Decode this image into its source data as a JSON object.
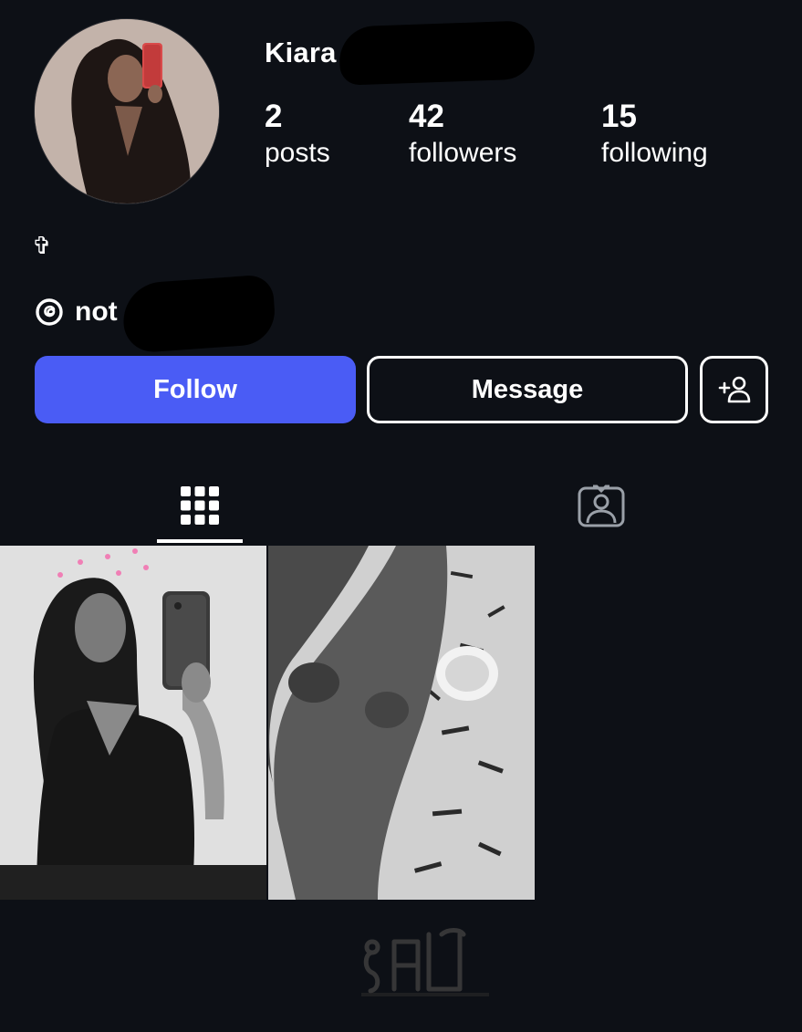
{
  "profile": {
    "username": "Kiara",
    "stats": {
      "posts_count": "2",
      "posts_label": "posts",
      "followers_count": "42",
      "followers_label": "followers",
      "following_count": "15",
      "following_label": "following"
    },
    "bio_symbol": "✞",
    "threads_text": "not"
  },
  "actions": {
    "follow_label": "Follow",
    "message_label": "Message"
  },
  "tabs": [
    {
      "icon": "grid-icon",
      "active": true
    },
    {
      "icon": "tagged-person-icon",
      "active": false
    }
  ],
  "posts": [
    {
      "description_icon": "mirror-selfie-photo"
    },
    {
      "description_icon": "legs-on-letter-sheet-photo"
    }
  ],
  "colors": {
    "background": "#0d1016",
    "follow_button": "#4a5cf5",
    "text": "#ffffff"
  }
}
